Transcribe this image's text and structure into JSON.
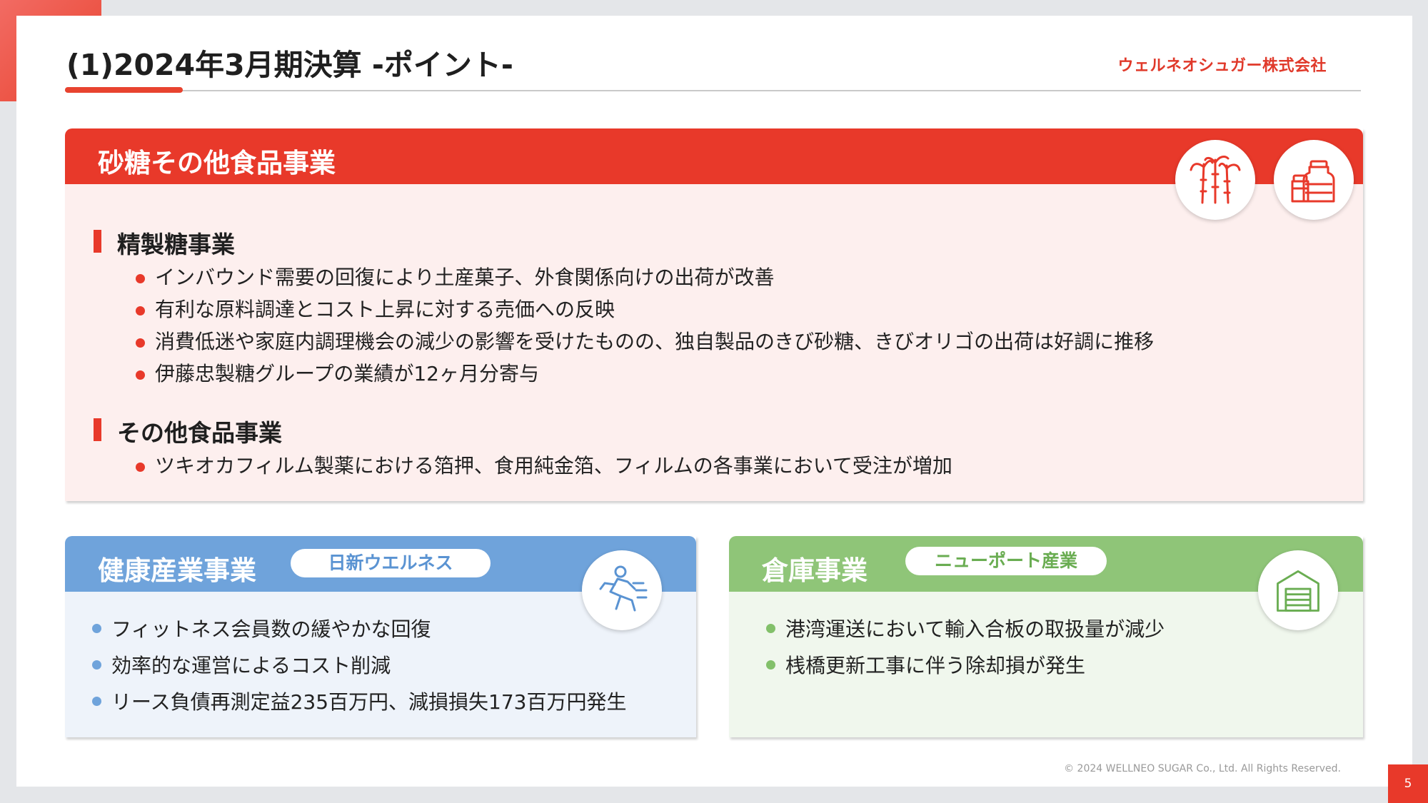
{
  "slide": {
    "title": "(1)2024年3月期決算 -ポイント-",
    "brand": "ウェルネオシュガー株式会社",
    "copyright": "© 2024 WELLNEO SUGAR Co., Ltd. All Rights Reserved.",
    "page_number": "5"
  },
  "sugar_panel": {
    "title": "砂糖その他食品事業",
    "icons": [
      "sugarcane-icon",
      "packaged-food-icon"
    ],
    "sections": [
      {
        "heading": "精製糖事業",
        "bullets": [
          "インバウンド需要の回復により土産菓子、外食関係向けの出荷が改善",
          "有利な原料調達とコスト上昇に対する売価への反映",
          "消費低迷や家庭内調理機会の減少の影響を受けたものの、独自製品のきび砂糖、きびオリゴの出荷は好調に推移",
          "伊藤忠製糖グループの業績が12ヶ月分寄与"
        ]
      },
      {
        "heading": "その他食品事業",
        "bullets": [
          "ツキオカフィルム製薬における箔押、食用純金箔、フィルムの各事業において受注が増加"
        ]
      }
    ]
  },
  "health_panel": {
    "title": "健康産業事業",
    "company": "日新ウエルネス",
    "icon": "runner-icon",
    "bullets": [
      "フィットネス会員数の緩やかな回復",
      "効率的な運営によるコスト削減",
      "リース負債再測定益235百万円、減損損失173百万円発生"
    ]
  },
  "warehouse_panel": {
    "title": "倉庫事業",
    "company": "ニューポート産業",
    "icon": "warehouse-icon",
    "bullets": [
      "港湾運送において輸入合板の取扱量が減少",
      "桟橋更新工事に伴う除却損が発生"
    ]
  },
  "colors": {
    "accent_red": "#e8392a",
    "health_blue": "#6fa3db",
    "warehouse_green": "#8fc578",
    "sugar_body": "#fdefee",
    "health_body": "#eef3fa",
    "warehouse_body": "#f0f7ed"
  }
}
